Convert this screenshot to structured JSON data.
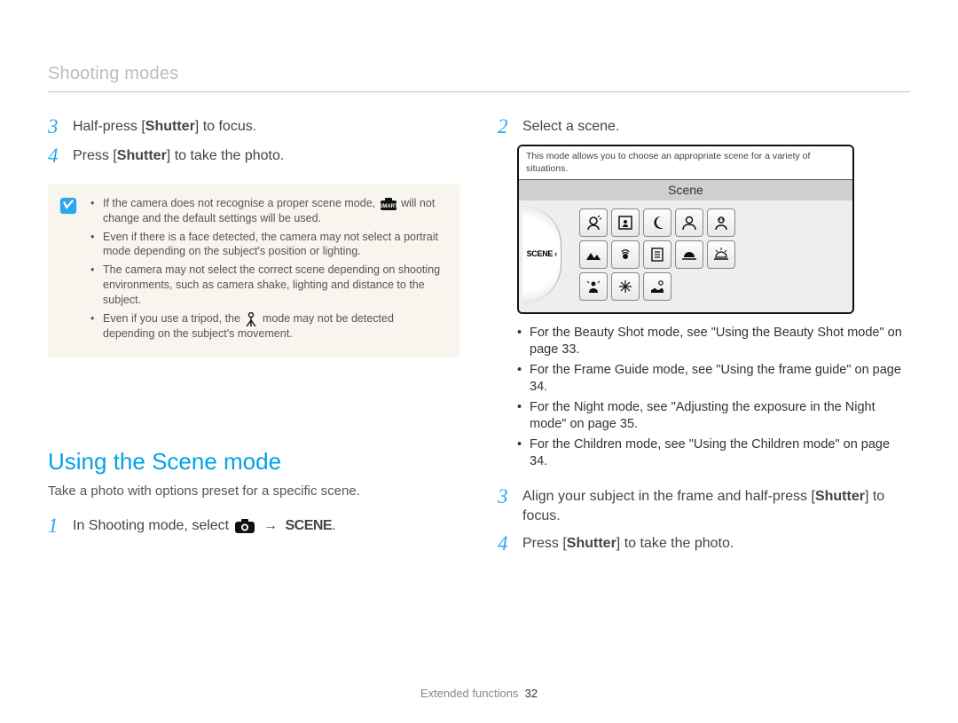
{
  "header": {
    "title": "Shooting modes"
  },
  "left": {
    "step3_num": "3",
    "step3_pre": "Half-press [",
    "step3_b": "Shutter",
    "step3_post": "] to focus.",
    "step4_num": "4",
    "step4_pre": "Press [",
    "step4_b": "Shutter",
    "step4_post": "] to take the photo.",
    "notes": {
      "n1a": "If the camera does not recognise a proper scene mode, ",
      "n1b": " will not change and the default settings will be used.",
      "n2": "Even if there is a face detected, the camera may not select a portrait mode depending on the subject's position or lighting.",
      "n3": "The camera may not select the correct scene depending on shooting environments, such as camera shake, lighting and distance to the subject.",
      "n4a": "Even if you use a tripod, the ",
      "n4b": " mode may not be detected depending on the subject's movement."
    },
    "scene_heading": "Using the Scene mode",
    "scene_sub": "Take a photo with options preset for a specific scene.",
    "step1_num": "1",
    "step1_text_pre": "In Shooting mode, select ",
    "step1_arrow": "→",
    "step1_scene_word": "SCENE",
    "step1_text_post": "."
  },
  "right": {
    "step2_num": "2",
    "step2_text": "Select a scene.",
    "lcd_desc": "This mode allows you to choose an appropriate scene for a variety of situations.",
    "lcd_title": "Scene",
    "dial_label": "SCENE ‹",
    "refs": {
      "r1": "For the Beauty Shot mode, see \"Using the Beauty Shot mode\" on page 33.",
      "r2": "For the Frame Guide mode, see \"Using the frame guide\" on page 34.",
      "r3": "For the Night mode, see \"Adjusting the exposure in the Night mode\" on page 35.",
      "r4": "For the Children mode, see \"Using the Children mode\" on page 34."
    },
    "step3_num": "3",
    "step3_pre": "Align your subject in the frame and half-press [",
    "step3_b": "Shutter",
    "step3_post": "] to focus.",
    "step4_num": "4",
    "step4_pre": "Press [",
    "step4_b": "Shutter",
    "step4_post": "] to take the photo."
  },
  "footer": {
    "section": "Extended functions",
    "page": "32"
  }
}
